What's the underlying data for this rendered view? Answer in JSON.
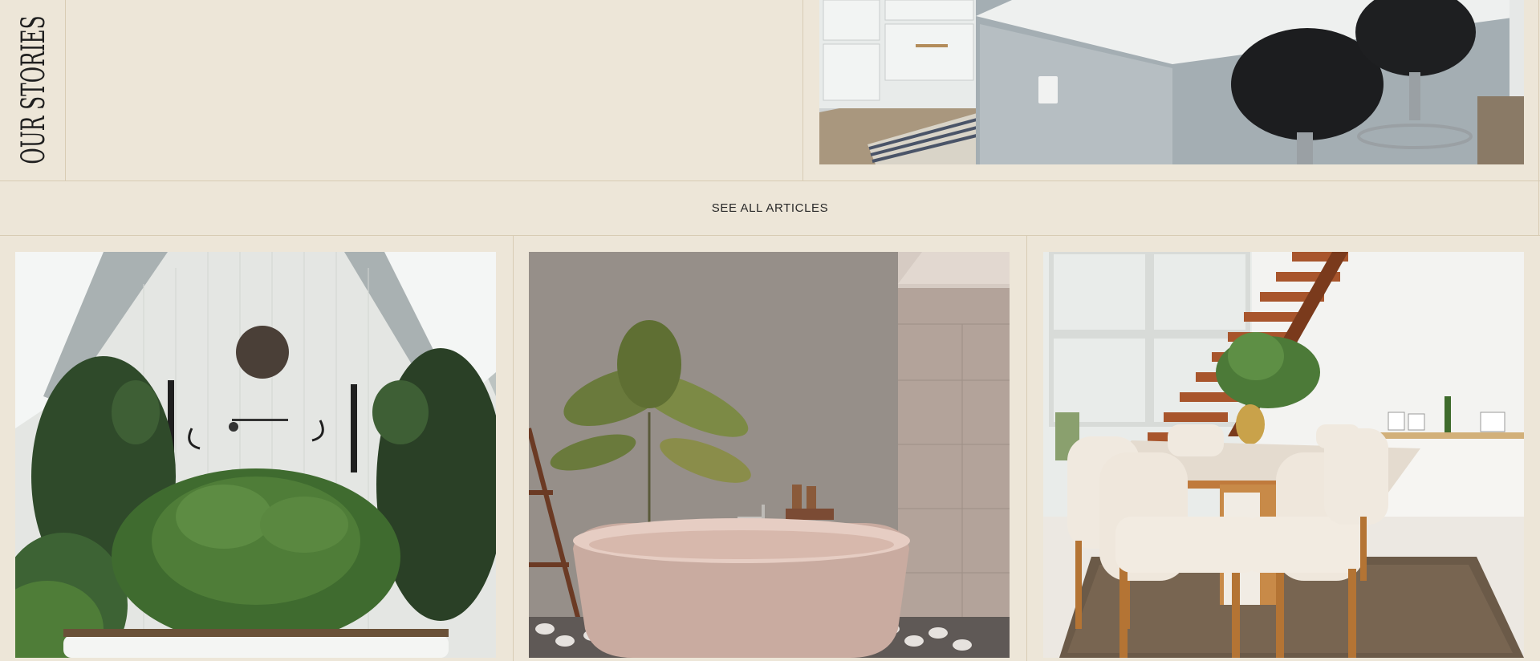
{
  "stories": {
    "section_title": "OUR STORIES",
    "see_all_label": "SEE ALL ARTICLES"
  },
  "images": {
    "featured": "kitchen-island-with-black-bar-stools",
    "cards": [
      "attic-bathroom-with-ferns-and-candle-holders",
      "pink-freestanding-bathtub-with-palm",
      "dining-room-with-wooden-staircase"
    ]
  },
  "colors": {
    "background": "#ede6d8",
    "divider": "#d8ccb4",
    "text": "#222222"
  }
}
